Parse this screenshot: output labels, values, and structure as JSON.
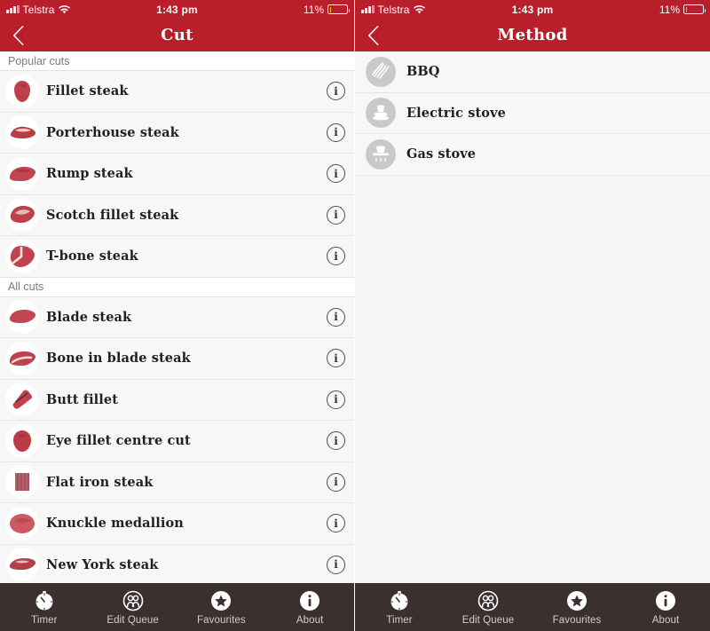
{
  "status_bar": {
    "carrier": "Telstra",
    "time": "1:43 pm",
    "battery_percent": "11%",
    "battery_level": 11,
    "signal_icon": "signal-bars-icon",
    "wifi_icon": "wifi-icon",
    "battery_icon": "battery-low-icon"
  },
  "colors": {
    "brand_red": "#b91e2b",
    "tabbar_dark": "#3a312e",
    "row_bg": "#f7f7f7",
    "battery_yellow": "#ffd21f",
    "method_icon_bg": "#c9c9c9"
  },
  "left_screen": {
    "nav": {
      "title": "Cut",
      "back_icon": "chevron-left-icon"
    },
    "sections": [
      {
        "header": "Popular cuts",
        "items": [
          {
            "label": "Fillet steak",
            "thumb": "fillet-steak-thumb",
            "info_icon": "info-icon"
          },
          {
            "label": "Porterhouse steak",
            "thumb": "porterhouse-steak-thumb",
            "info_icon": "info-icon"
          },
          {
            "label": "Rump steak",
            "thumb": "rump-steak-thumb",
            "info_icon": "info-icon"
          },
          {
            "label": "Scotch fillet steak",
            "thumb": "scotch-fillet-steak-thumb",
            "info_icon": "info-icon"
          },
          {
            "label": "T-bone steak",
            "thumb": "t-bone-steak-thumb",
            "info_icon": "info-icon"
          }
        ]
      },
      {
        "header": "All cuts",
        "items": [
          {
            "label": "Blade steak",
            "thumb": "blade-steak-thumb",
            "info_icon": "info-icon"
          },
          {
            "label": "Bone in blade steak",
            "thumb": "bone-in-blade-steak-thumb",
            "info_icon": "info-icon"
          },
          {
            "label": "Butt fillet",
            "thumb": "butt-fillet-thumb",
            "info_icon": "info-icon"
          },
          {
            "label": "Eye fillet centre cut",
            "thumb": "eye-fillet-centre-cut-thumb",
            "info_icon": "info-icon"
          },
          {
            "label": "Flat iron steak",
            "thumb": "flat-iron-steak-thumb",
            "info_icon": "info-icon"
          },
          {
            "label": "Knuckle medallion",
            "thumb": "knuckle-medallion-thumb",
            "info_icon": "info-icon"
          },
          {
            "label": "New York steak",
            "thumb": "new-york-steak-thumb",
            "info_icon": "info-icon"
          }
        ]
      }
    ]
  },
  "right_screen": {
    "nav": {
      "title": "Method",
      "back_icon": "chevron-left-icon"
    },
    "items": [
      {
        "label": "BBQ",
        "icon": "bbq-grill-icon"
      },
      {
        "label": "Electric stove",
        "icon": "electric-stove-icon"
      },
      {
        "label": "Gas stove",
        "icon": "gas-stove-icon"
      }
    ]
  },
  "tabbar": {
    "tabs": [
      {
        "label": "Timer",
        "icon": "timer-icon"
      },
      {
        "label": "Edit Queue",
        "icon": "edit-queue-icon"
      },
      {
        "label": "Favourites",
        "icon": "star-icon"
      },
      {
        "label": "About",
        "icon": "info-icon"
      }
    ]
  }
}
